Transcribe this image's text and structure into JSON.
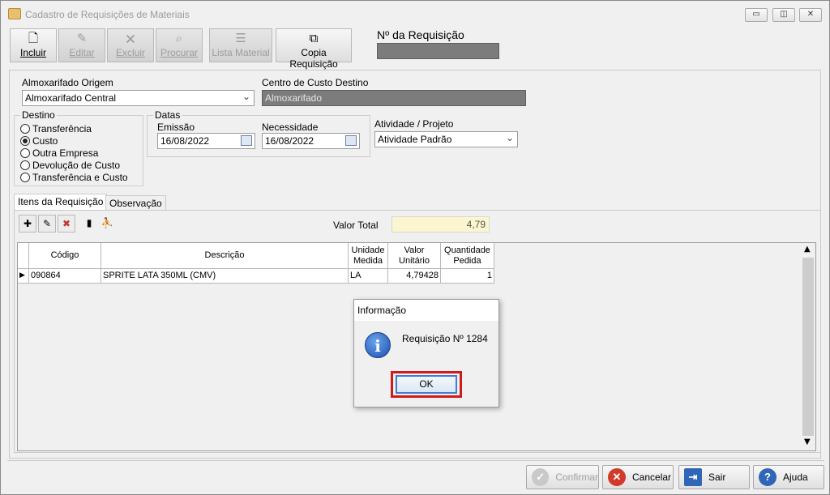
{
  "window": {
    "title": "Cadastro de Requisições de Materiais",
    "controls": {
      "minimize": "▭",
      "restore": "◫",
      "close": "✕"
    }
  },
  "toolbar": {
    "incluir": "Incluir",
    "editar": "Editar",
    "excluir": "Excluir",
    "procurar": "Procurar",
    "lista_material": "Lista Material",
    "copia_requisicao": "Copia Requisição"
  },
  "requisicao": {
    "label": "Nº da Requisição",
    "value": ""
  },
  "form": {
    "almox_origem_label": "Almoxarifado Origem",
    "almox_origem_value": "Almoxarifado Central",
    "centro_custo_label": "Centro de Custo Destino",
    "centro_custo_value": "Almoxarifado",
    "destino_label": "Destino",
    "destino_options": [
      "Transferência",
      "Custo",
      "Outra Empresa",
      "Devolução de Custo",
      "Transferência e Custo"
    ],
    "destino_selected": "Custo",
    "datas_label": "Datas",
    "emissao_label": "Emissão",
    "emissao_value": "16/08/2022",
    "necessidade_label": "Necessidade",
    "necessidade_value": "16/08/2022",
    "atividade_label": "Atividade / Projeto",
    "atividade_value": "Atividade Padrão"
  },
  "tabs": {
    "itens": "Itens da Requisição",
    "observacao": "Observação"
  },
  "items": {
    "valor_total_label": "Valor Total",
    "valor_total_value": "4,79",
    "columns": [
      "Código",
      "Descrição",
      "Unidade\nMedida",
      "Valor\nUnitário",
      "Quantidade\nPedida"
    ],
    "rows": [
      {
        "codigo": "090864",
        "descricao": "SPRITE LATA 350ML (CMV)",
        "unidade": "LA",
        "valor": "4,79428",
        "quantidade": "1"
      }
    ]
  },
  "dialog": {
    "title": "Informação",
    "message": "Requisição Nº 1284",
    "ok": "OK"
  },
  "bottom": {
    "confirmar": "Confirmar",
    "cancelar": "Cancelar",
    "sair": "Sair",
    "ajuda": "Ajuda"
  },
  "colors": {
    "highlight": "#d21a1a",
    "valor_total_bg": "#fbf6cf",
    "readonly_bg": "#7c7c7c"
  }
}
